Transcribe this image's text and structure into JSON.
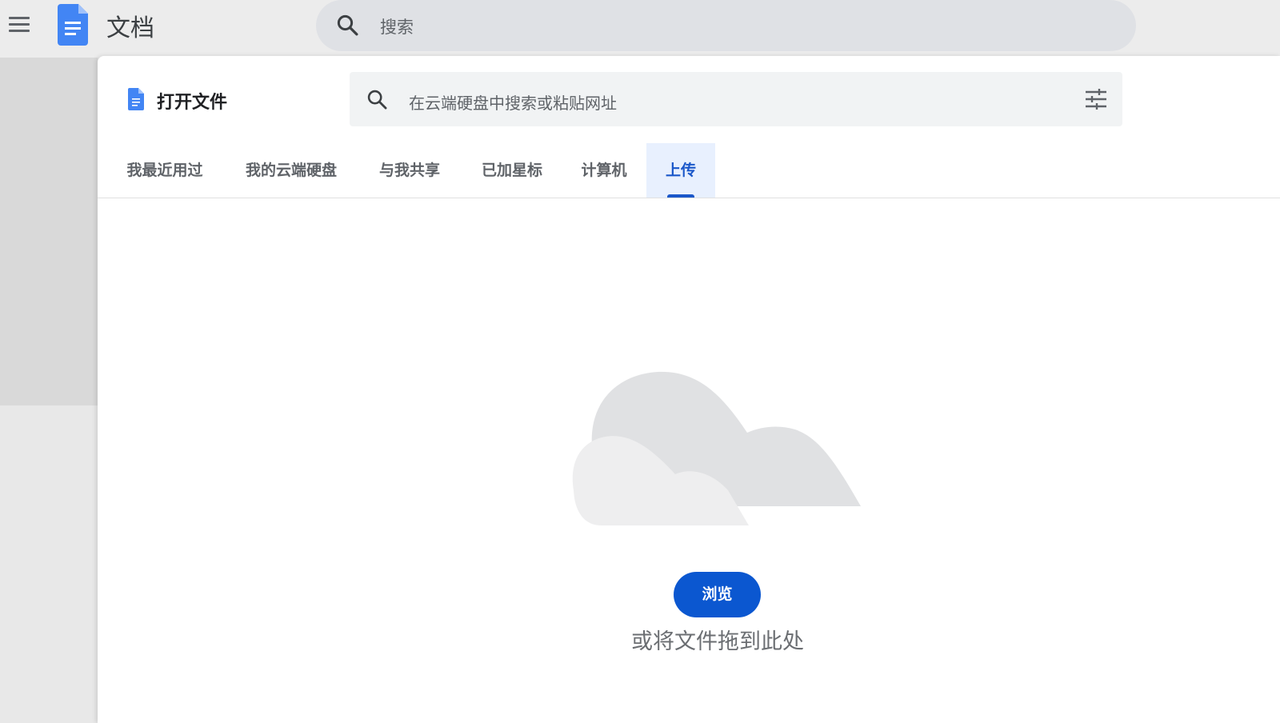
{
  "app": {
    "title": "文档",
    "search_placeholder": "搜索"
  },
  "dialog": {
    "title": "打开文件",
    "search_placeholder": "在云端硬盘中搜索或粘贴网址",
    "tabs": [
      {
        "label": "我最近用过",
        "active": false
      },
      {
        "label": "我的云端硬盘",
        "active": false
      },
      {
        "label": "与我共享",
        "active": false
      },
      {
        "label": "已加星标",
        "active": false
      },
      {
        "label": "计算机",
        "active": false
      },
      {
        "label": "上传",
        "active": true
      }
    ],
    "upload": {
      "browse_label": "浏览",
      "drop_hint": "或将文件拖到此处"
    }
  },
  "colors": {
    "accent": "#0b57d0",
    "docs_blue": "#4285f4",
    "active_tab_bg": "#e8f0fe"
  },
  "icons": [
    "menu-icon",
    "docs-logo-icon",
    "search-icon",
    "filter-icon",
    "cloud-illustration"
  ]
}
